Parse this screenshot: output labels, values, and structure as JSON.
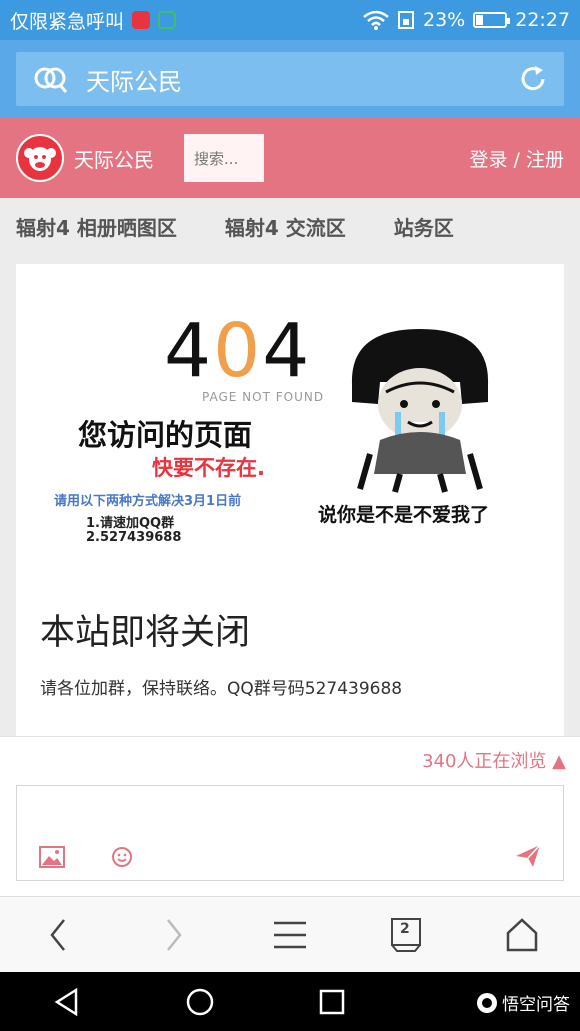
{
  "status_bar": {
    "carrier": "仅限紧急呼叫",
    "battery": "23%",
    "time": "22:27",
    "battery_level": 0.23
  },
  "browser": {
    "address_title": "天际公民"
  },
  "site": {
    "name": "天际公民",
    "search_placeholder": "搜索...",
    "auth_label": "登录 / 注册"
  },
  "nav": {
    "items": [
      "辐射4 相册晒图区",
      "辐射4 交流区",
      "站务区"
    ]
  },
  "image_content": {
    "num_4a": "4",
    "num_0": "0",
    "num_4b": "4",
    "page_not_found": "PAGE NOT FOUND",
    "line1": "您访问的页面",
    "line2": "快要不存在.",
    "line3": "请用以下两种方式解决3月1日前",
    "line4": "1.请速加QQ群",
    "line5": "2.527439688",
    "meme_caption": "说你是不是不爱我了"
  },
  "article": {
    "headline": "本站即将关闭",
    "body": "请各位加群，保持联络。QQ群号码527439688"
  },
  "comments": {
    "viewers": "340人正在浏览 ▲"
  },
  "bottombar": {
    "tab_count": "2"
  },
  "watermark": "悟空问答"
}
